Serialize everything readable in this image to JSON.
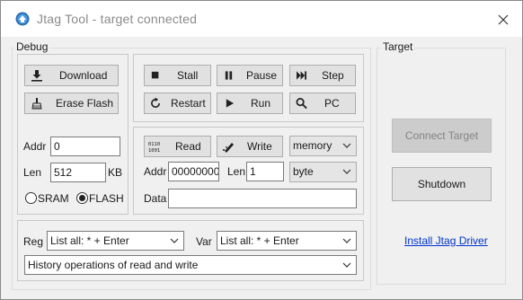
{
  "window": {
    "title": "Jtag Tool - target connected"
  },
  "debug": {
    "group_label": "Debug",
    "download_label": "Download",
    "erase_flash_label": "Erase Flash",
    "addr_label": "Addr",
    "addr_value": "0",
    "len_label": "Len",
    "len_value": "512",
    "len_unit": "KB",
    "sram_label": "SRAM",
    "flash_label": "FLASH",
    "selected_memory": "FLASH",
    "stall_label": "Stall",
    "pause_label": "Pause",
    "step_label": "Step",
    "restart_label": "Restart",
    "run_label": "Run",
    "pc_label": "PC",
    "read_label": "Read",
    "write_label": "Write",
    "mem_type": "memory",
    "rw_addr_label": "Addr",
    "rw_addr_value": "00000000",
    "rw_len_label": "Len",
    "rw_len_value": "1",
    "unit_type": "byte",
    "data_label": "Data",
    "data_value": "",
    "reg_label": "Reg",
    "reg_value": "List all:  * + Enter",
    "var_label": "Var",
    "var_value": "List all:  * + Enter",
    "history_value": "History operations of read and write"
  },
  "target": {
    "group_label": "Target",
    "connect_label": "Connect Target",
    "shutdown_label": "Shutdown",
    "install_label": "Install Jtag Driver"
  },
  "colors": {
    "link": "#0033cc",
    "disabled_text": "#838383",
    "button_face": "#e1e1e1"
  }
}
